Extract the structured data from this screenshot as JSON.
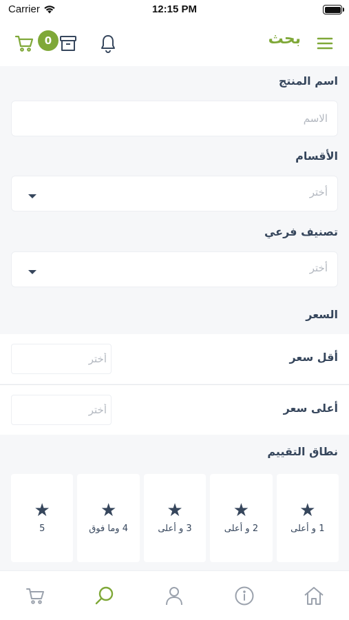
{
  "status_bar": {
    "carrier": "Carrier",
    "time": "12:15 PM"
  },
  "nav": {
    "title": "بحث",
    "cart_count": "0"
  },
  "form": {
    "product_name_label": "اسم المنتج",
    "product_name_placeholder": "الاسم",
    "categories_label": "الأقسام",
    "categories_value": "أختر",
    "subcategory_label": "تصنيف فرعي",
    "subcategory_value": "أختر",
    "price_label": "السعر",
    "min_price_label": "أقل سعر",
    "min_price_placeholder": "أختر",
    "max_price_label": "أعلى سعر",
    "max_price_placeholder": "أختر",
    "rating_label": "نطاق التقييم"
  },
  "ratings": [
    {
      "label": "5"
    },
    {
      "label": "4 وما فوق"
    },
    {
      "label": "3 و أعلى"
    },
    {
      "label": "2 و أعلى"
    },
    {
      "label": "1 و أعلى"
    }
  ],
  "colors": {
    "accent": "#7fa838",
    "text": "#36465c",
    "background": "#f6f7f9"
  },
  "icons": {
    "nav": [
      "cart-icon",
      "archive-icon",
      "bell-icon",
      "menu-icon"
    ],
    "tabs": [
      "cart-icon",
      "search-icon",
      "user-icon",
      "info-icon",
      "home-icon"
    ]
  }
}
